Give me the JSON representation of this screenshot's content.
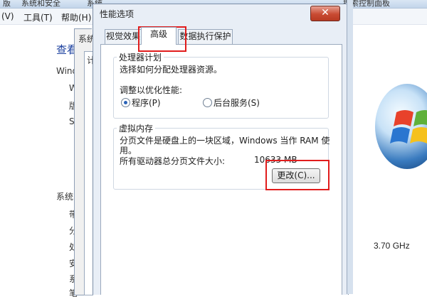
{
  "background_window": {
    "topbar_items": [
      "版",
      "系统和安全",
      "系统",
      "搜索控制面板"
    ],
    "menus": [
      "(V)",
      "工具(T)",
      "帮助(H)"
    ],
    "page_link": "查看",
    "left_labels": [
      "Wind",
      "W",
      "版",
      "S",
      "系统",
      "带",
      "分",
      "处",
      "安",
      "系",
      "笔"
    ],
    "processor_speed": "3.70 GHz"
  },
  "back_dialog": {
    "tab_label_partial": "系统",
    "inner_tab_partial": "计"
  },
  "dialog": {
    "title": "性能选项",
    "close_symbol": "✕",
    "tabs": [
      {
        "label": "视觉效果",
        "active": false
      },
      {
        "label": "高级",
        "active": true
      },
      {
        "label": "数据执行保护",
        "active": false
      }
    ],
    "processor_scheduling": {
      "title": "处理器计划",
      "description": "选择如何分配处理器资源。",
      "adjust_label": "调整以优化性能:",
      "options": [
        {
          "label": "程序(P)",
          "checked": true
        },
        {
          "label": "后台服务(S)",
          "checked": false
        }
      ]
    },
    "virtual_memory": {
      "title": "虚拟内存",
      "description_line1": "分页文件是硬盘上的一块区域，Windows 当作 RAM 使",
      "description_line2": "用。",
      "total_label": "所有驱动器总分页文件大小:",
      "total_value": "10633 MB",
      "change_button": "更改(C)..."
    }
  },
  "colors": {
    "highlight_box": "#e11c1c",
    "radio_fill": "#2b63b8",
    "close_button": "#c94b33"
  }
}
